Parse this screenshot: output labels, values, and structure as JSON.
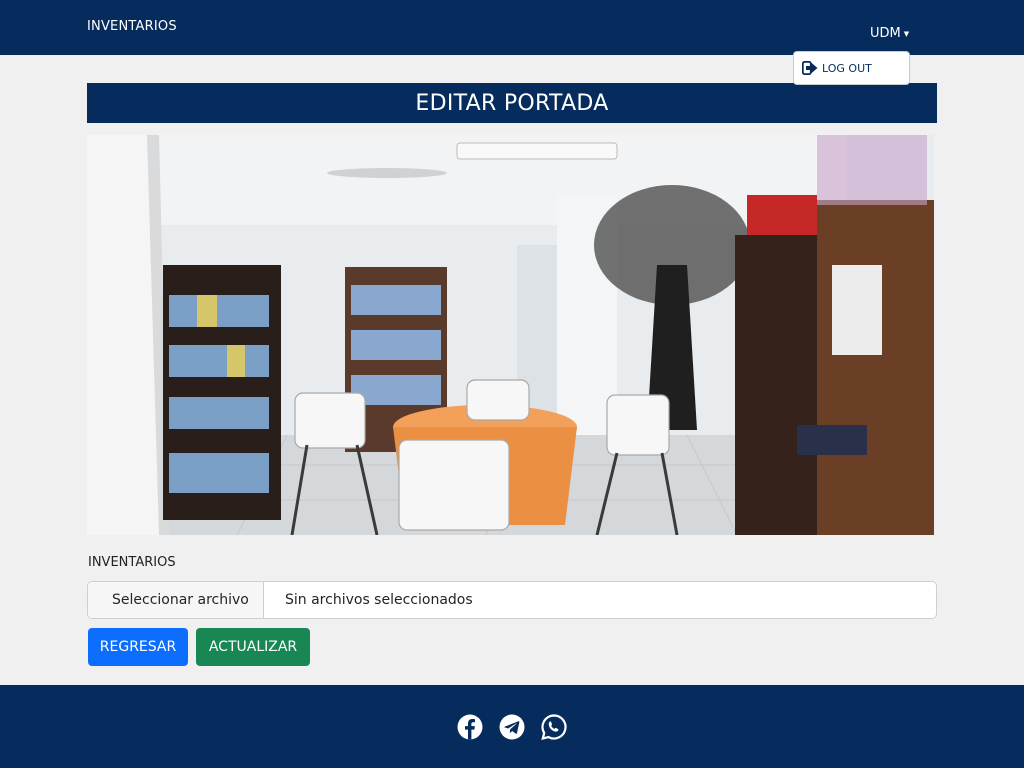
{
  "navbar": {
    "brand": "INVENTARIOS",
    "user": "UDM",
    "dropdown": {
      "logout_label": "LOG OUT"
    }
  },
  "page": {
    "title": "EDITAR PORTADA"
  },
  "form": {
    "label": "INVENTARIOS",
    "file_button": "Seleccionar archivo",
    "file_status": "Sin archivos seleccionados",
    "back_button": "REGRESAR",
    "update_button": "ACTUALIZAR"
  },
  "cover_image": {
    "subject": "library-room-photo"
  },
  "footer": {
    "social": [
      "facebook-icon",
      "telegram-icon",
      "whatsapp-icon"
    ]
  },
  "colors": {
    "navy": "#052c5c",
    "primary": "#0d6efd",
    "success": "#198754",
    "background": "#f0f0f0"
  }
}
